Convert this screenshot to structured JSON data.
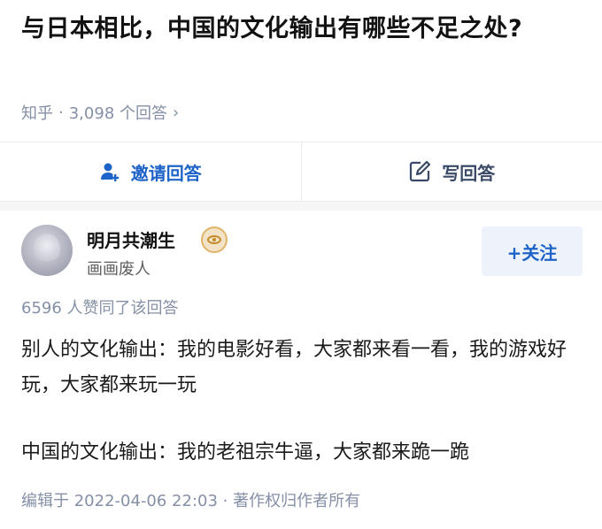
{
  "question": {
    "title": "与日本相比，中国的文化输出有哪些不足之处?",
    "source": "知乎",
    "answer_count": "3,098 个回答"
  },
  "actions": {
    "invite_label": "邀请回答",
    "write_label": "写回答"
  },
  "answer": {
    "author_name": "明月共潮生",
    "author_bio": "画画废人",
    "follow_label": "+关注",
    "likes": "6596 人赞同了该回答",
    "paragraphs": [
      "别人的文化输出：我的电影好看，大家都来看一看，我的游戏好玩，大家都来玩一玩",
      "中国的文化输出：我的老祖宗牛逼，大家都来跪一跪"
    ],
    "edit_meta": "编辑于 2022-04-06 22:03 · 著作权归作者所有"
  },
  "colors": {
    "accent": "#1e63c8",
    "muted": "#8590a6",
    "text": "#1a1a1a"
  },
  "icons": {
    "invite": "add-user-icon",
    "write": "edit-icon",
    "chevron": "chevron-right-icon",
    "badge": "eye-badge-icon"
  }
}
